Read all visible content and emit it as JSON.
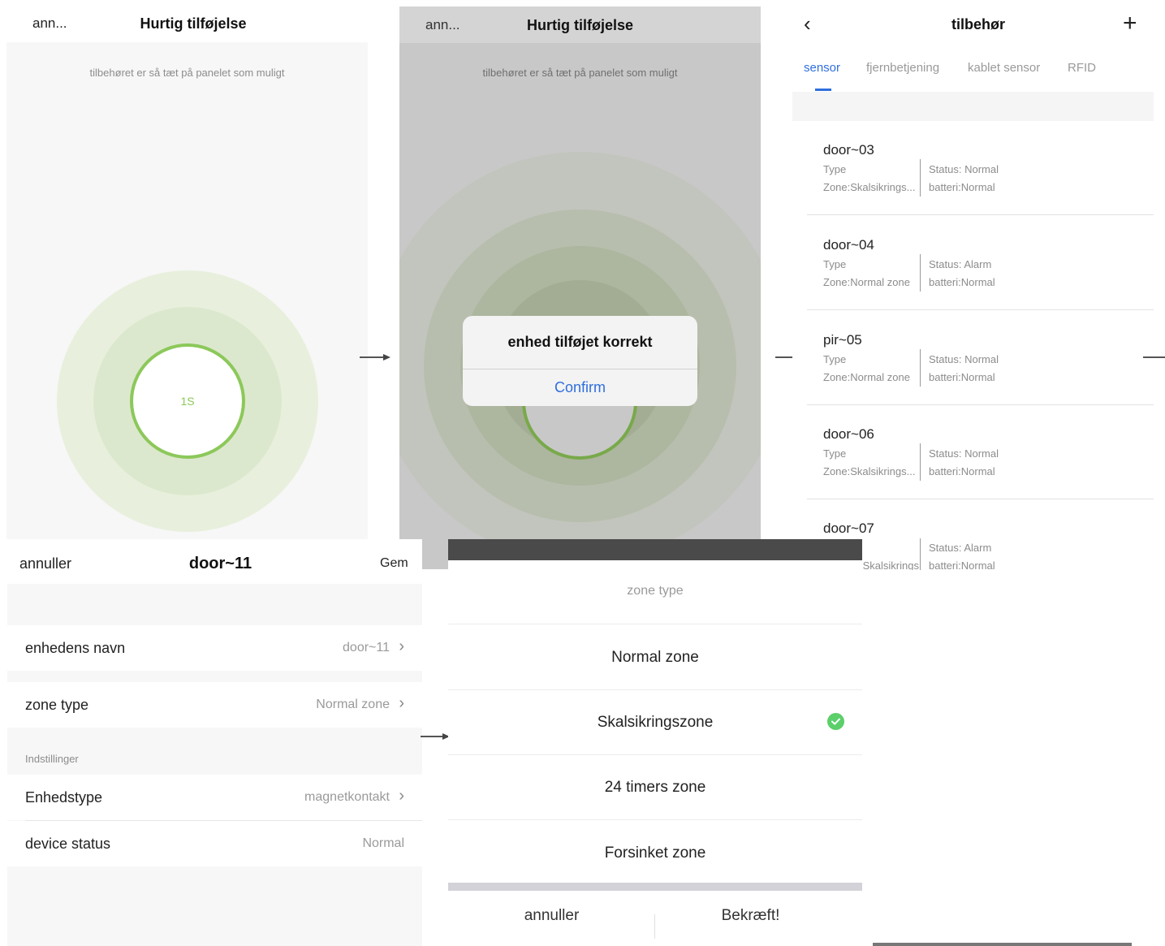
{
  "panel1": {
    "cancel": "ann...",
    "title": "Hurtig tilføjelse",
    "hint": "tilbehøret er så tæt på panelet som muligt",
    "countdown": "1S"
  },
  "panel2": {
    "cancel": "ann...",
    "title": "Hurtig tilføjelse",
    "hint": "tilbehøret er så tæt på panelet som muligt",
    "dialog": {
      "message": "enhed tilføjet korrekt",
      "confirm": "Confirm"
    }
  },
  "panel3": {
    "back_icon": "chevron-left-icon",
    "title": "tilbehør",
    "add_icon": "plus-icon",
    "tabs": [
      {
        "label": "sensor",
        "active": true
      },
      {
        "label": "fjernbetjening",
        "active": false
      },
      {
        "label": "kablet sensor",
        "active": false
      },
      {
        "label": "RFID",
        "active": false
      }
    ],
    "devices": [
      {
        "name": "door~03",
        "type": "Type",
        "zone": "Zone:Skalsikrings...",
        "status": "Status: Normal",
        "battery": "batteri:Normal"
      },
      {
        "name": "door~04",
        "type": "Type",
        "zone": "Zone:Normal zone",
        "status": "Status: Alarm",
        "battery": "batteri:Normal"
      },
      {
        "name": "pir~05",
        "type": "Type",
        "zone": "Zone:Normal zone",
        "status": "Status: Normal",
        "battery": "batteri:Normal"
      },
      {
        "name": "door~06",
        "type": "Type",
        "zone": "Zone:Skalsikrings...",
        "status": "Status: Normal",
        "battery": "batteri:Normal"
      },
      {
        "name": "door~07",
        "type": "",
        "zone": "Zone:Skalsikrings...",
        "status": "Status: Alarm",
        "battery": "batteri:Normal"
      }
    ]
  },
  "panel4": {
    "cancel": "annuller",
    "title": "door~11",
    "save": "Gem",
    "rows": {
      "name_label": "enhedens navn",
      "name_value": "door~11",
      "zone_label": "zone type",
      "zone_value": "Normal zone",
      "section": "Indstillinger",
      "type_label": "Enhedstype",
      "type_value": "magnetkontakt",
      "status_label": "device status",
      "status_value": "Normal"
    }
  },
  "panel5": {
    "title": "zone type",
    "options": [
      {
        "label": "Normal zone",
        "selected": false
      },
      {
        "label": "Skalsikringszone",
        "selected": true
      },
      {
        "label": "24 timers zone",
        "selected": false
      },
      {
        "label": "Forsinket zone",
        "selected": false
      }
    ],
    "cancel": "annuller",
    "confirm": "Bekræft!",
    "check_color": "#5ccf6a"
  },
  "colors": {
    "accent_blue": "#2f6fde",
    "ring_green": "#8cc85a",
    "countdown_green": "#8cc85a"
  }
}
